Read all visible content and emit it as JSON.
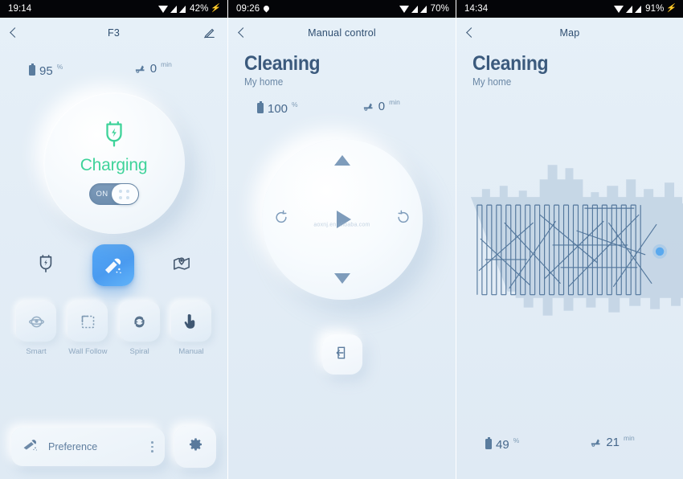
{
  "panel1": {
    "status": {
      "time": "19:14",
      "battery_pct": "42%",
      "icons": [
        "wifi-icon",
        "signal-icon",
        "signal-icon",
        "charging-bolt-icon"
      ]
    },
    "nav": {
      "back": "back-chevron-icon",
      "title": "F3",
      "edit": "pencil-icon"
    },
    "stats": {
      "battery_value": "95",
      "battery_unit": "%",
      "time_value": "0",
      "time_unit": "min"
    },
    "status_circle": {
      "icon": "charging-shield-icon",
      "label": "Charging",
      "toggle_label": "ON",
      "toggle_state": "on"
    },
    "actions": [
      {
        "name": "dock-charge-button",
        "icon": "shield-bolt-icon"
      },
      {
        "name": "clean-start-button",
        "icon": "robot-vacuum-icon"
      },
      {
        "name": "zone-map-button",
        "icon": "map-pin-icon"
      }
    ],
    "modes": [
      {
        "label": "Smart",
        "icon": "smart-icon"
      },
      {
        "label": "Wall Follow",
        "icon": "wall-follow-icon"
      },
      {
        "label": "Spiral",
        "icon": "spiral-icon"
      },
      {
        "label": "Manual",
        "icon": "manual-hand-icon"
      }
    ],
    "bottom": {
      "preference_label": "Preference",
      "preference_icon": "vacuum-icon",
      "more_icon": "more-vertical-icon",
      "settings_icon": "gear-icon"
    }
  },
  "panel2": {
    "status": {
      "time": "09:26",
      "battery_pct": "70%",
      "icons": [
        "location-pin-icon",
        "wifi-icon",
        "signal-icon",
        "signal-icon"
      ]
    },
    "nav": {
      "back": "back-chevron-icon",
      "title": "Manual control"
    },
    "heading": {
      "title": "Cleaning",
      "subtitle": "My home"
    },
    "stats": {
      "battery_value": "100",
      "battery_unit": "%",
      "time_value": "0",
      "time_unit": "min"
    },
    "dpad": {
      "up": "triangle-up-icon",
      "down": "triangle-down-icon",
      "rotate_left": "rotate-ccw-icon",
      "rotate_right": "rotate-cw-icon",
      "center": "play-icon",
      "watermark": "aoxnj.en.alibaba.com"
    },
    "exit": {
      "icon": "exit-icon"
    }
  },
  "panel3": {
    "status": {
      "time": "14:34",
      "battery_pct": "91%",
      "icons": [
        "wifi-icon",
        "signal-icon",
        "signal-icon",
        "charging-bolt-icon"
      ]
    },
    "nav": {
      "back": "back-chevron-icon",
      "title": "Map"
    },
    "heading": {
      "title": "Cleaning",
      "subtitle": "My home"
    },
    "stats": {
      "battery_value": "49",
      "battery_unit": "%",
      "time_value": "21",
      "time_unit": "min"
    },
    "map": {
      "robot_marker": "robot-position-dot",
      "path_color": "#4a6f96",
      "wall_color": "#aec4d8"
    }
  },
  "colors": {
    "background": "#e4eef7",
    "accent_blue": "#4a9bf0",
    "charging_green": "#3fd39a",
    "text_dark": "#3b5a7d",
    "text_muted": "#8fa8c0",
    "statusbar": "#040508"
  }
}
